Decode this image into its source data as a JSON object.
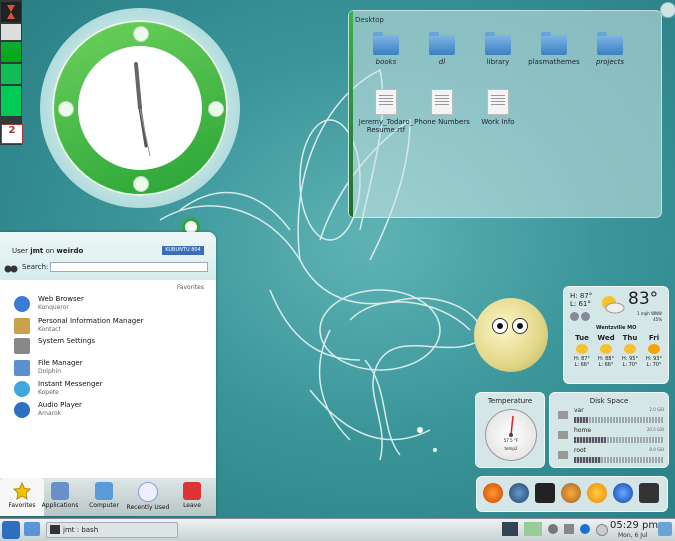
{
  "desktop": {
    "title": "Desktop",
    "items": [
      {
        "label": "books",
        "type": "folder"
      },
      {
        "label": "dl",
        "type": "folder"
      },
      {
        "label": "library",
        "type": "folder"
      },
      {
        "label": "plasmathemes",
        "type": "folder"
      },
      {
        "label": "projects",
        "type": "folder"
      },
      {
        "label": "Jeremy_Todaro_Resume.rtf",
        "type": "doc"
      },
      {
        "label": "Phone Numbers",
        "type": "doc"
      },
      {
        "label": "Work Info",
        "type": "doc"
      }
    ]
  },
  "menu": {
    "user_prefix": "User ",
    "user": "jmt",
    "on": " on ",
    "host": "weirdo",
    "brand": "KUBUNTU 804",
    "search_label": "Search:",
    "search_placeholder": "",
    "favorites_header": "Favorites",
    "items": [
      {
        "title": "Web Browser",
        "sub": "Konqueror",
        "icon": "globe-icon",
        "color": "#3a7bd5"
      },
      {
        "title": "Personal Information Manager",
        "sub": "Kontact",
        "icon": "contacts-icon",
        "color": "#c9a14a"
      },
      {
        "title": "System Settings",
        "sub": "",
        "icon": "tools-icon",
        "color": "#888"
      },
      {
        "title": "File Manager",
        "sub": "Dolphin",
        "icon": "file-manager-icon",
        "color": "#5a8fd0"
      },
      {
        "title": "Instant Messenger",
        "sub": "Kopete",
        "icon": "messenger-icon",
        "color": "#3fa7e0"
      },
      {
        "title": "Audio Player",
        "sub": "Amarok",
        "icon": "amarok-icon",
        "color": "#2d6fc0"
      }
    ],
    "tabs": [
      {
        "label": "Favorites",
        "icon": "star-icon",
        "color": "#f5c400"
      },
      {
        "label": "Applications",
        "icon": "applications-icon",
        "color": "#6b8fc9"
      },
      {
        "label": "Computer",
        "icon": "computer-icon",
        "color": "#5a9ad8"
      },
      {
        "label": "Recently Used",
        "icon": "clock-icon",
        "color": "#7fa6d8"
      },
      {
        "label": "Leave",
        "icon": "power-icon",
        "color": "#d33"
      }
    ]
  },
  "weather": {
    "hi": "H: 87°",
    "lo": "L: 61°",
    "temp": "83°",
    "wind": "1 mph WNW",
    "humidity": "45%",
    "location": "Wentzville MO",
    "days": [
      {
        "name": "Tue",
        "hi": "H: 87°",
        "lo": "L: 66°"
      },
      {
        "name": "Wed",
        "hi": "H: 88°",
        "lo": "L: 66°"
      },
      {
        "name": "Thu",
        "hi": "H: 95°",
        "lo": "L: 70°"
      },
      {
        "name": "Fri",
        "hi": "H: 93°",
        "lo": "L: 70°"
      }
    ]
  },
  "temperature": {
    "title": "Temperature",
    "value": "57.5 °F",
    "sensor": "temp2"
  },
  "disk": {
    "title": "Disk Space",
    "rows": [
      {
        "name": "var",
        "size": "2.0 GiB",
        "fill": 0.15
      },
      {
        "name": "home",
        "size": "20.5 GiB",
        "fill": 0.35
      },
      {
        "name": "root",
        "size": "8.0 GiB",
        "fill": 0.3
      }
    ]
  },
  "taskbar": {
    "task": "jmt : bash",
    "time": "05:29 pm",
    "date": "Mon, 6 Jul"
  },
  "launchers": [
    "firefox-icon",
    "thunderbird-icon",
    "inkscape-icon",
    "gimp-icon",
    "goldfish-icon",
    "konqueror-icon",
    "terminal-icon"
  ]
}
